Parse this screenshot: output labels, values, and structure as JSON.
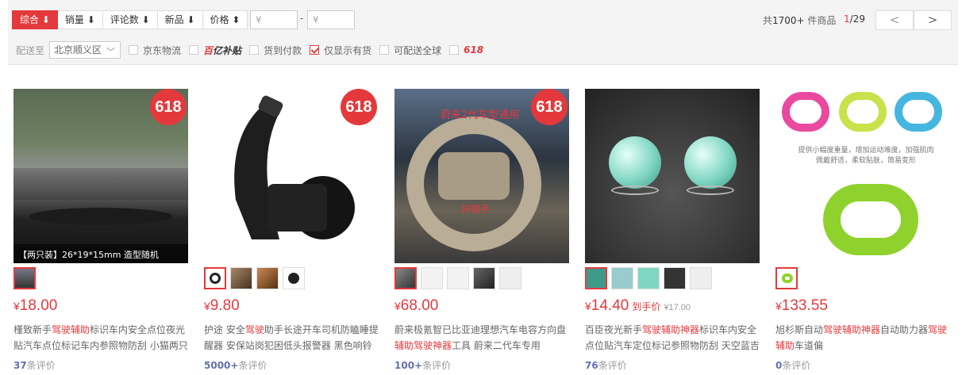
{
  "sort_tabs": [
    {
      "label": "综合 ⬇",
      "active": true
    },
    {
      "label": "销量 ⬇",
      "active": false
    },
    {
      "label": "评论数 ⬇",
      "active": false
    },
    {
      "label": "新品 ⬇",
      "active": false
    },
    {
      "label": "价格 ⬍",
      "active": false
    }
  ],
  "price_filter": {
    "min_placeholder": "¥",
    "max_placeholder": "¥",
    "separator": "-"
  },
  "summary": {
    "prefix": "共",
    "count": "1700+",
    "suffix": " 件商品"
  },
  "pager": {
    "current": "1",
    "total": "/29",
    "prev": "<",
    "next": ">"
  },
  "filters": {
    "ship_to_label": "配送至",
    "location": "北京顺义区",
    "options": [
      {
        "label": "京东物流",
        "checked": false
      },
      {
        "label": "百亿补贴",
        "checked": false
      },
      {
        "label": "货到付款",
        "checked": false
      },
      {
        "label": "仅显示有货",
        "checked": true
      },
      {
        "label": "可配送全球",
        "checked": false
      },
      {
        "label": "618",
        "checked": false
      }
    ],
    "yibu_logo": "亿补贴"
  },
  "products": [
    {
      "badge": "618",
      "image_caption": "【两只装】26*19*15mm 造型随机",
      "price": "18.00",
      "currency": "¥",
      "title_parts": [
        "槿致新手",
        "驾驶辅助",
        "标识车内安全点位夜光贴汽车点位标记车内参照物防刮 小猫两只"
      ],
      "reviews_count": "37",
      "reviews_label": "条评价",
      "thumb_count": 1
    },
    {
      "badge": "618",
      "image_caption": "",
      "price": "9.80",
      "currency": "¥",
      "title_parts": [
        "护途 安全",
        "驾驶",
        "助手长途开车司机防瞌睡提醒器 安保站岗犯困低头报警器 黑色响铃"
      ],
      "reviews_count": "5000+",
      "reviews_label": "条评价",
      "thumb_count": 4
    },
    {
      "badge": "618",
      "image_caption": "蔚来2代车型通用",
      "image_caption2": "好帮手",
      "price": "68.00",
      "currency": "¥",
      "title_parts": [
        "蔚来极氪智已比亚迪理想汽车电容方向盘",
        "辅助驾驶神器",
        "工具 蔚来二代车专用"
      ],
      "reviews_count": "100+",
      "reviews_label": "条评价",
      "thumb_count": 7
    },
    {
      "badge": "",
      "image_caption": "",
      "price": "14.40",
      "currency": "¥",
      "hand_label": "到手价",
      "old_price": "¥17.00",
      "title_parts": [
        "百臣夜光新手",
        "驾驶辅助神器",
        "标识车内安全点位贴汽车定位标记参照物防刮 天空蓝吉"
      ],
      "reviews_count": "76",
      "reviews_label": "条评价",
      "thumb_count": 7
    },
    {
      "badge": "",
      "image_caption": "提供小幅度重量，增加运动难度，加强肌肉 佩戴舒适，柔软贴肤，简易变形",
      "price": "133.55",
      "currency": "¥",
      "title_parts": [
        "旭杉斯自动",
        "驾驶辅助神器",
        "自动助力器",
        "驾驶辅助",
        "车道偏"
      ],
      "reviews_count": "0",
      "reviews_label": "条评价",
      "thumb_count": 1
    }
  ],
  "colors": {
    "accent": "#e4393c",
    "review_count": "#646fb0"
  }
}
